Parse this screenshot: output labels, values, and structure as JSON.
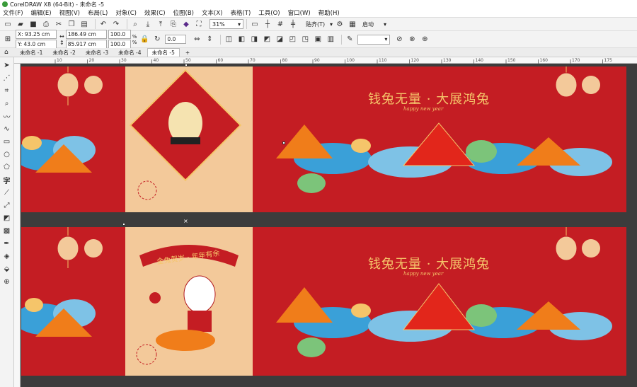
{
  "window": {
    "title": "CorelDRAW X8 (64-Bit) - 未命名 -5"
  },
  "menu": [
    "文件(F)",
    "编辑(E)",
    "视图(V)",
    "布局(L)",
    "对象(C)",
    "效果(C)",
    "位图(B)",
    "文本(X)",
    "表格(T)",
    "工具(O)",
    "窗口(W)",
    "帮助(H)"
  ],
  "toolbar": {
    "zoom": "31%",
    "snap_label": "贴齐(T)",
    "launch_label": "启动"
  },
  "propbar": {
    "x": "X: 93.25 cm",
    "y": "Y: 43.0 cm",
    "w": "186.49 cm",
    "h": "85.917 cm",
    "sx": "100.0",
    "sy": "100.0",
    "pct1": "%",
    "pct2": "%",
    "angle": "0.0"
  },
  "tabs": [
    "未命名 -1",
    "未命名 -2",
    "未命名 -3",
    "未命名 -4",
    "未命名 -5"
  ],
  "ruler_ticks": [
    "10",
    "20",
    "30",
    "40",
    "50",
    "60",
    "70",
    "80",
    "90",
    "100",
    "110",
    "120",
    "130",
    "140",
    "150",
    "160",
    "170",
    "175"
  ],
  "design": {
    "headline": "钱兔无量 · 大展鸿兔",
    "script": "happy new year",
    "banner": "金兔贺岁 · 年年有余"
  },
  "colors": {
    "red": "#c41d23",
    "cream": "#f3c99a",
    "gold": "#f5c56a",
    "orange": "#f07d1a",
    "blue": "#3aa0d8",
    "green": "#7cc47a"
  }
}
